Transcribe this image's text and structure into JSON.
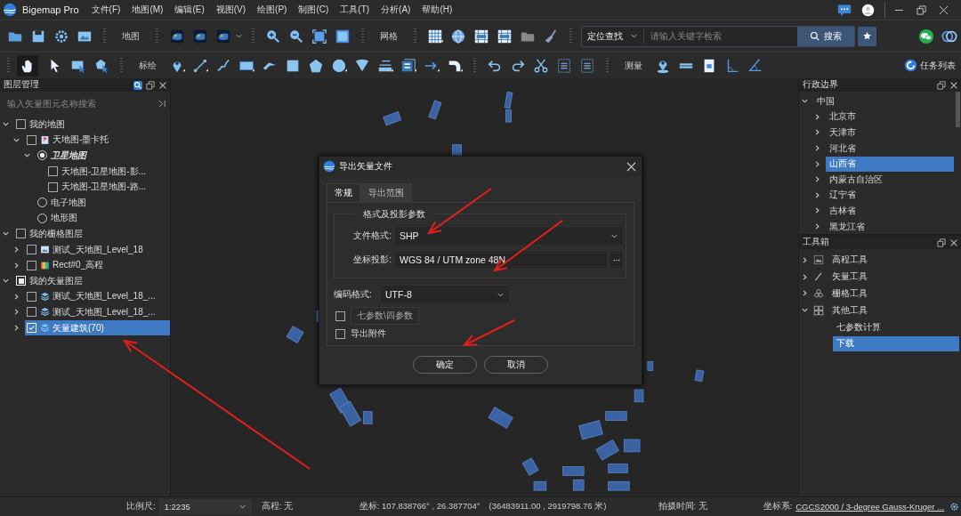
{
  "app": {
    "name": "Bigemap Pro"
  },
  "menu": [
    "文件(F)",
    "地图(M)",
    "编辑(E)",
    "视图(V)",
    "绘图(P)",
    "制图(C)",
    "工具(T)",
    "分析(A)",
    "帮助(H)"
  ],
  "toolbar": {
    "map_label": "地图",
    "grid_label": "网格",
    "search_mode": "定位查找",
    "search_placeholder": "请输入关键字检索",
    "search_button": "搜索"
  },
  "draw_toolbar": {
    "label": "标绘",
    "measure_label": "测量",
    "tasks": "任务列表"
  },
  "layer_panel": {
    "title": "图层管理",
    "search_placeholder": "输入矢量图元名称搜索",
    "tree": [
      {
        "label": "我的地图",
        "checked": false,
        "partial": false,
        "expanded": true,
        "selected": false,
        "children": [
          {
            "label": "天地图-墨卡托",
            "kind": "basemap",
            "checked": false,
            "expanded": true,
            "selected": false,
            "children": [
              {
                "label": "卫星地图",
                "kind": "radio",
                "checked": true,
                "expanded": true,
                "selected": false,
                "children": [
                  {
                    "label": "天地图-卫星地图-影...",
                    "checked": false,
                    "selected": false
                  },
                  {
                    "label": "天地图-卫星地图-路...",
                    "checked": false,
                    "selected": false
                  }
                ]
              },
              {
                "label": "电子地图",
                "kind": "radio",
                "checked": false,
                "selected": false
              },
              {
                "label": "地形图",
                "kind": "radio",
                "checked": false,
                "selected": false
              }
            ]
          }
        ]
      },
      {
        "label": "我的栅格图层",
        "checked": false,
        "partial": false,
        "expanded": true,
        "selected": false,
        "children": [
          {
            "label": "测试_天地图_Level_18",
            "kind": "raster",
            "checked": false,
            "expanded": false,
            "selected": false
          },
          {
            "label": "Rect#0_高程",
            "kind": "dem",
            "checked": false,
            "expanded": false,
            "selected": false
          }
        ]
      },
      {
        "label": "我的矢量图层",
        "checked": true,
        "partial": true,
        "expanded": true,
        "selected": false,
        "children": [
          {
            "label": "测试_天地图_Level_18_...",
            "kind": "vector",
            "checked": false,
            "expanded": false,
            "selected": false
          },
          {
            "label": "测试_天地图_Level_18_...",
            "kind": "vector",
            "checked": false,
            "expanded": false,
            "selected": false
          },
          {
            "label": "矢量建筑(70)",
            "kind": "vector",
            "checked": true,
            "expanded": false,
            "selected": true
          }
        ]
      }
    ]
  },
  "region_panel": {
    "title": "行政边界",
    "tree": [
      {
        "label": "中国",
        "expanded": true,
        "selected": false,
        "children": [
          {
            "label": "北京市",
            "expanded": false,
            "selected": false
          },
          {
            "label": "天津市",
            "expanded": false,
            "selected": false
          },
          {
            "label": "河北省",
            "expanded": false,
            "selected": false
          },
          {
            "label": "山西省",
            "expanded": false,
            "selected": true
          },
          {
            "label": "内蒙古自治区",
            "expanded": false,
            "selected": false
          },
          {
            "label": "辽宁省",
            "expanded": false,
            "selected": false
          },
          {
            "label": "吉林省",
            "expanded": false,
            "selected": false
          },
          {
            "label": "黑龙江省",
            "expanded": false,
            "selected": false
          }
        ]
      }
    ]
  },
  "toolbox_panel": {
    "title": "工具箱",
    "tree": [
      {
        "label": "高程工具",
        "kind": "elevation",
        "expanded": false,
        "selected": false
      },
      {
        "label": "矢量工具",
        "kind": "vector",
        "expanded": false,
        "selected": false
      },
      {
        "label": "栅格工具",
        "kind": "raster",
        "expanded": false,
        "selected": false
      },
      {
        "label": "其他工具",
        "kind": "other",
        "expanded": true,
        "selected": false,
        "children": [
          {
            "label": "七参数计算",
            "selected": false
          },
          {
            "label": "下载",
            "selected": true
          }
        ]
      }
    ]
  },
  "dialog": {
    "title": "导出矢量文件",
    "tabs": [
      {
        "label": "常规",
        "selected": true
      },
      {
        "label": "导出范围",
        "selected": false
      }
    ],
    "group_title": "格式及投影参数",
    "fields": [
      {
        "kind": "select",
        "label": "文件格式:",
        "value": "SHP"
      },
      {
        "kind": "browse",
        "label": "坐标投影:",
        "value": "WGS 84 / UTM zone 48N"
      }
    ],
    "encoding": {
      "label": "编码格式:",
      "value": "UTF-8"
    },
    "options": [
      {
        "kind": "button",
        "label": "七参数\\四参数",
        "checked": false
      },
      {
        "kind": "plain",
        "label": "导出附件",
        "checked": false
      }
    ],
    "buttons": [
      "确定",
      "取消"
    ]
  },
  "status_bar": {
    "scale_label": "比例尺:",
    "scale": "1:2235",
    "elevation": "高程: 无",
    "coords": "坐标: 107.838766° , 26.387704°",
    "projected": "(36483911.00 , 2919798.76 米)",
    "capture_time": "拍摄时间: 无",
    "crs_label": "坐标系:",
    "crs": "CGCS2000 / 3-degree Gauss-Kruger ..."
  }
}
